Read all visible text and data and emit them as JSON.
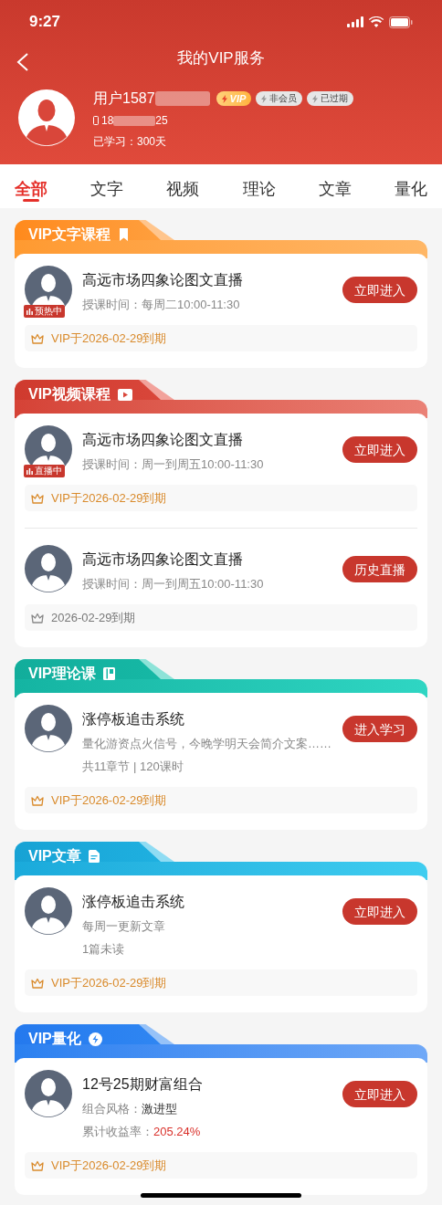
{
  "status_bar": {
    "time": "9:27"
  },
  "header": {
    "title": "我的VIP服务"
  },
  "profile": {
    "name": "用户1587",
    "badges": [
      {
        "text": "VIP",
        "kind": "vip"
      },
      {
        "text": "非会员",
        "kind": "gray"
      },
      {
        "text": "已过期",
        "kind": "gray"
      }
    ],
    "phone_start": "18",
    "phone_end": "25",
    "study": "已学习：300天"
  },
  "tabs": [
    {
      "label": "全部",
      "selected": true
    },
    {
      "label": "文字",
      "selected": false
    },
    {
      "label": "视频",
      "selected": false
    },
    {
      "label": "理论",
      "selected": false
    },
    {
      "label": "文章",
      "selected": false
    },
    {
      "label": "量化",
      "selected": false
    }
  ],
  "sections": [
    {
      "title": "VIP文字课程",
      "kind": "text",
      "items": [
        {
          "title": "高远市场四象论图文直播",
          "badge": "预热中",
          "lines": [
            {
              "label": "授课时间：每周二10:00-11:30",
              "kind": "plain"
            }
          ],
          "button": "立即进入",
          "expiry": {
            "text": "VIP于2026-02-29到期",
            "kind": "vip"
          }
        }
      ]
    },
    {
      "title": "VIP视频课程",
      "kind": "video",
      "items": [
        {
          "title": "高远市场四象论图文直播",
          "badge": "直播中",
          "lines": [
            {
              "label": "授课时间：周一到周五10:00-11:30",
              "kind": "plain"
            }
          ],
          "button": "立即进入",
          "expiry": {
            "text": "VIP于2026-02-29到期",
            "kind": "vip"
          }
        },
        {
          "title": "高远市场四象论图文直播",
          "lines": [
            {
              "label": "授课时间：周一到周五10:00-11:30",
              "kind": "plain"
            }
          ],
          "button": "历史直播",
          "expiry": {
            "text": "2026-02-29到期",
            "kind": "plain"
          }
        }
      ]
    },
    {
      "title": "VIP理论课",
      "kind": "theory",
      "items": [
        {
          "title": "涨停板追击系统",
          "lines": [
            {
              "label": "量化游资点火信号，今晚学明天会简介文案……",
              "kind": "plain"
            },
            {
              "label": "共11章节 | 120课时",
              "kind": "plain"
            }
          ],
          "button": "进入学习",
          "expiry": {
            "text": "VIP于2026-02-29到期",
            "kind": "vip"
          }
        }
      ]
    },
    {
      "title": "VIP文章",
      "kind": "article",
      "items": [
        {
          "title": "涨停板追击系统",
          "lines": [
            {
              "label": "每周一更新文章",
              "kind": "plain"
            },
            {
              "label": "1篇未读",
              "kind": "plain"
            }
          ],
          "button": "立即进入",
          "expiry": {
            "text": "VIP于2026-02-29到期",
            "kind": "vip"
          }
        }
      ]
    },
    {
      "title": "VIP量化",
      "kind": "quant",
      "items": [
        {
          "title": "12号25期财富组合",
          "lines": [
            {
              "label": "组合风格：",
              "value": "激进型",
              "kind": "strong"
            },
            {
              "label": "累计收益率：",
              "value": "205.24%",
              "kind": "highlight"
            }
          ],
          "button": "立即进入",
          "expiry": {
            "text": "VIP于2026-02-29到期",
            "kind": "vip"
          }
        }
      ]
    }
  ]
}
